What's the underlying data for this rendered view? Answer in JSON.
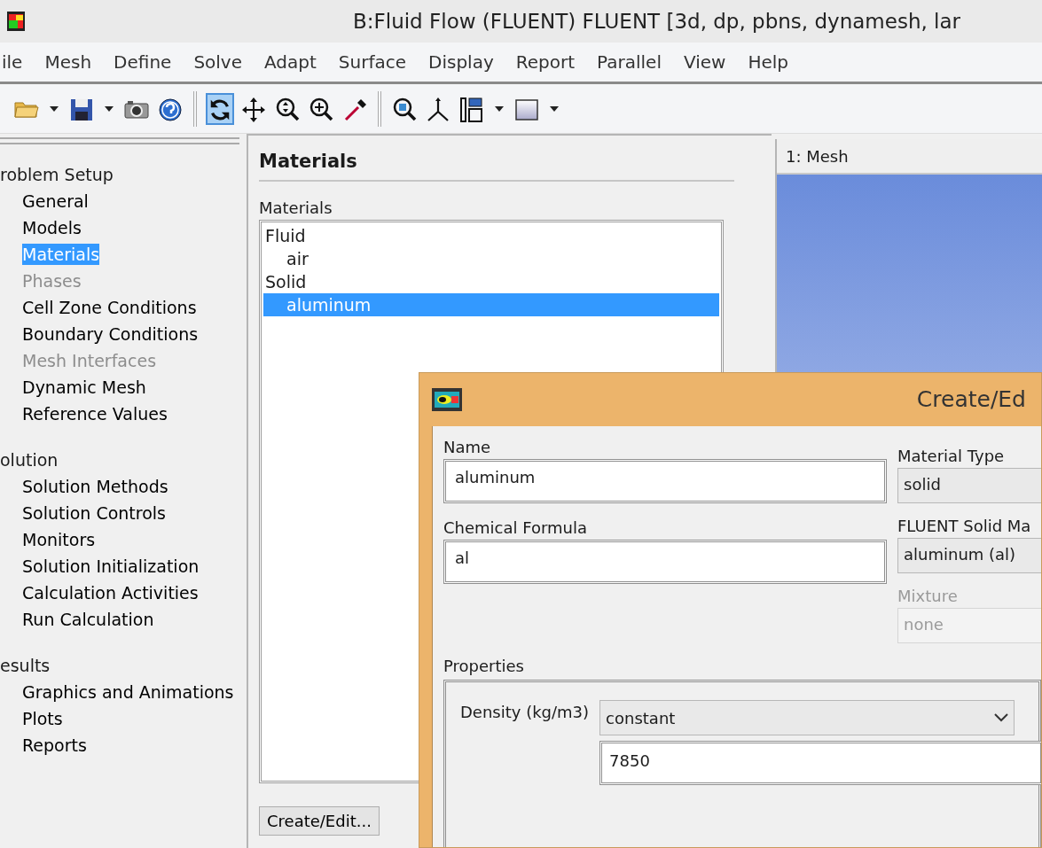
{
  "window": {
    "title": "B:Fluid Flow (FLUENT) FLUENT  [3d, dp, pbns, dynamesh, lar"
  },
  "menu": [
    "ile",
    "Mesh",
    "Define",
    "Solve",
    "Adapt",
    "Surface",
    "Display",
    "Report",
    "Parallel",
    "View",
    "Help"
  ],
  "toolbar": [
    [
      {
        "kind": "folder",
        "selected": false
      },
      {
        "kind": "caret",
        "selected": false
      },
      {
        "kind": "save",
        "selected": false
      },
      {
        "kind": "caret",
        "selected": false
      },
      {
        "kind": "camera",
        "selected": false
      },
      {
        "kind": "help",
        "selected": false
      }
    ],
    [
      {
        "kind": "rotate",
        "selected": true
      },
      {
        "kind": "move",
        "selected": false
      },
      {
        "kind": "zoomfit",
        "selected": false
      },
      {
        "kind": "zoomin",
        "selected": false
      },
      {
        "kind": "probe",
        "selected": false
      }
    ],
    [
      {
        "kind": "zoombox",
        "selected": false
      },
      {
        "kind": "axes",
        "selected": false
      },
      {
        "kind": "layout",
        "selected": false
      },
      {
        "kind": "caret",
        "selected": false
      },
      {
        "kind": "frame",
        "selected": false
      },
      {
        "kind": "caret",
        "selected": false
      }
    ]
  ],
  "sidebar": {
    "groups": [
      {
        "label": "roblem Setup",
        "items": [
          {
            "label": "General",
            "selected": false,
            "disabled": false
          },
          {
            "label": "Models",
            "selected": false,
            "disabled": false
          },
          {
            "label": "Materials",
            "selected": true,
            "disabled": false
          },
          {
            "label": "Phases",
            "selected": false,
            "disabled": true
          },
          {
            "label": "Cell Zone Conditions",
            "selected": false,
            "disabled": false
          },
          {
            "label": "Boundary Conditions",
            "selected": false,
            "disabled": false
          },
          {
            "label": "Mesh Interfaces",
            "selected": false,
            "disabled": true
          },
          {
            "label": "Dynamic Mesh",
            "selected": false,
            "disabled": false
          },
          {
            "label": "Reference Values",
            "selected": false,
            "disabled": false
          }
        ]
      },
      {
        "label": "olution",
        "items": [
          {
            "label": "Solution Methods",
            "selected": false,
            "disabled": false
          },
          {
            "label": "Solution Controls",
            "selected": false,
            "disabled": false
          },
          {
            "label": "Monitors",
            "selected": false,
            "disabled": false
          },
          {
            "label": "Solution Initialization",
            "selected": false,
            "disabled": false
          },
          {
            "label": "Calculation Activities",
            "selected": false,
            "disabled": false
          },
          {
            "label": "Run Calculation",
            "selected": false,
            "disabled": false
          }
        ]
      },
      {
        "label": "esults",
        "items": [
          {
            "label": "Graphics and Animations",
            "selected": false,
            "disabled": false
          },
          {
            "label": "Plots",
            "selected": false,
            "disabled": false
          },
          {
            "label": "Reports",
            "selected": false,
            "disabled": false
          }
        ]
      }
    ]
  },
  "task_panel": {
    "title": "Materials",
    "list_label": "Materials",
    "materials": [
      {
        "label": "Fluid",
        "selected": false,
        "children": [
          {
            "label": "air",
            "selected": false
          }
        ]
      },
      {
        "label": "Solid",
        "selected": false,
        "children": [
          {
            "label": "aluminum",
            "selected": true
          }
        ]
      }
    ],
    "buttons": [
      "Create/Edit..."
    ]
  },
  "graphics": {
    "title": "1: Mesh"
  },
  "dialog": {
    "title": "Create/Ed",
    "name": {
      "label": "Name",
      "value": "aluminum"
    },
    "formula": {
      "label": "Chemical Formula",
      "value": "al"
    },
    "material_type": {
      "label": "Material Type",
      "value": "solid",
      "disabled": false
    },
    "database": {
      "label": "FLUENT Solid Ma",
      "value": "aluminum (al)",
      "disabled": false
    },
    "mixture": {
      "label": "Mixture",
      "value": "none",
      "disabled": true
    },
    "properties": {
      "label": "Properties",
      "rows": [
        {
          "label": "Density (kg/m3)",
          "method": "constant",
          "value": "7850"
        }
      ]
    }
  }
}
